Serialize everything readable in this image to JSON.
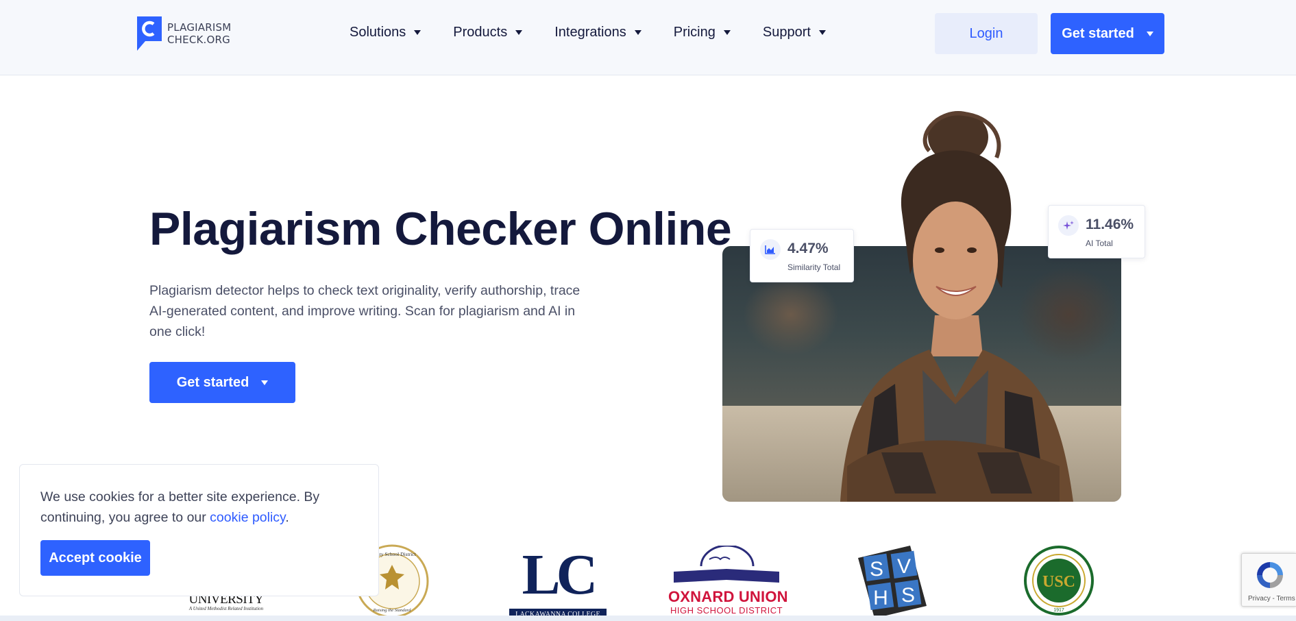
{
  "brand": {
    "line1": "PLAGIARISM",
    "line2": "CHECK.ORG"
  },
  "nav": {
    "items": [
      {
        "label": "Solutions"
      },
      {
        "label": "Products"
      },
      {
        "label": "Integrations"
      },
      {
        "label": "Pricing"
      },
      {
        "label": "Support"
      }
    ]
  },
  "header": {
    "login_label": "Login",
    "cta_label": "Get started"
  },
  "hero": {
    "title": "Plagiarism Checker Online",
    "description": "Plagiarism detector helps to check text originality, verify authorship, trace AI-generated content, and improve writing. Scan for plagiarism and AI in one click!",
    "cta_label": "Get started"
  },
  "stats": {
    "similarity": {
      "value": "4.47%",
      "label": "Similarity Total",
      "icon": "chart-icon"
    },
    "ai": {
      "value": "11.46%",
      "label": "AI Total",
      "icon": "sparkle-icon"
    }
  },
  "cookie": {
    "text_before": "We use cookies for a better site experience. By continuing, you agree to our ",
    "link_text": "cookie policy",
    "text_after": ".",
    "button_label": "Accept cookie"
  },
  "partners": {
    "university": {
      "name": "UNIVERSITY",
      "tagline": "A United Methodist Related Institution"
    },
    "district": {
      "arc": "County School District",
      "motto": "Raising the Standard"
    },
    "lackawanna": {
      "mark": "LC",
      "name": "LACKAWANNA COLLEGE"
    },
    "oxnard": {
      "line1": "OXNARD UNION",
      "line2": "HIGH SCHOOL DISTRICT"
    },
    "svhs": {
      "l1": "S",
      "l2": "V",
      "l3": "H",
      "l4": "S"
    },
    "usc": {
      "mark": "USC",
      "year": "1917"
    }
  },
  "recaptcha": {
    "links": "Privacy - Terms"
  },
  "colors": {
    "primary": "#2e62ff",
    "navy": "#14193c",
    "header_bg": "#f6f8fc"
  }
}
